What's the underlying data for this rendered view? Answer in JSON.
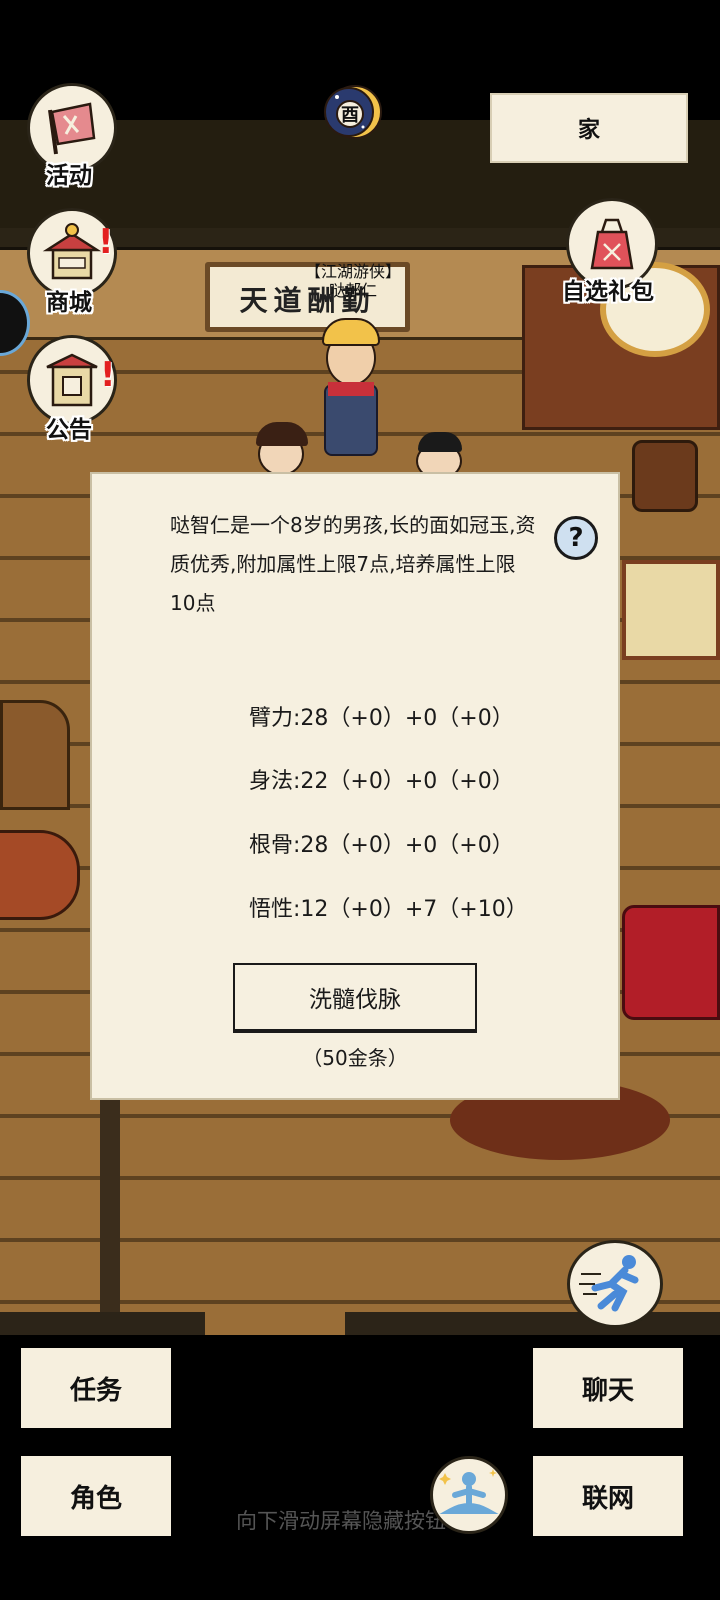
{
  "top_icons": [
    {
      "label": "活动",
      "icon": "flag-scroll-icon"
    },
    {
      "label": "商城",
      "icon": "shop-stall-icon"
    },
    {
      "label": "公告",
      "icon": "notice-board-icon"
    }
  ],
  "gift_pack": {
    "label": "自选礼包",
    "icon": "gift-bag-icon"
  },
  "home_button": {
    "label": "家"
  },
  "time_indicator": {
    "label": "酉",
    "icon": "moon-icon"
  },
  "scene": {
    "plaque_text": "天道酬勤",
    "npc_title": "【江湖游侠】",
    "npc_name": "哒郝仁"
  },
  "dialog": {
    "description": "哒智仁是一个8岁的男孩,长的面如冠玉,资质优秀,附加属性上限7点,培养属性上限10点",
    "help_label": "?",
    "stats": [
      {
        "text": "臂力:28（+0）+0（+0）"
      },
      {
        "text": "身法:22（+0）+0（+0）"
      },
      {
        "text": "根骨:28（+0）+0（+0）"
      },
      {
        "text": "悟性:12（+0）+7（+10）"
      }
    ],
    "action_label": "洗髓伐脉",
    "cost_label": "（50金条）"
  },
  "bottom_menu": {
    "tasks": "任务",
    "chat": "聊天",
    "character": "角色",
    "network": "联网"
  },
  "hint_text": "向下滑动屏幕隐藏按钮",
  "colors": {
    "panel": "#f6f0e0",
    "floor": "#9a6e38",
    "badge": "#e32020"
  }
}
